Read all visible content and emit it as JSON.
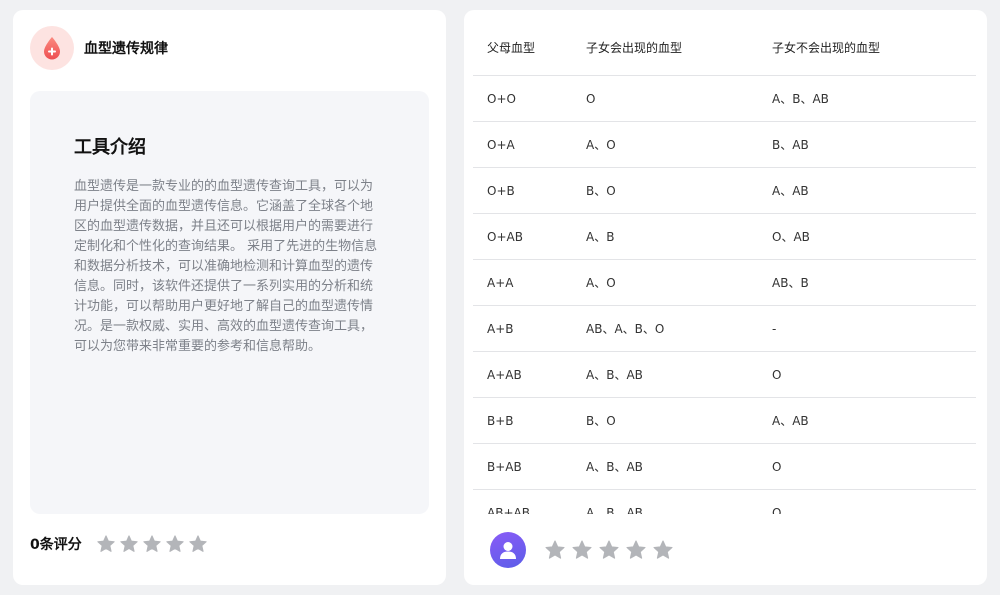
{
  "app": {
    "title": "血型遗传规律",
    "logo_icon": "blood-drop-icon"
  },
  "intro": {
    "heading": "工具介绍",
    "body": "血型遗传是一款专业的的血型遗传查询工具，可以为用户提供全面的血型遗传信息。它涵盖了全球各个地区的血型遗传数据，并且还可以根据用户的需要进行定制化和个性化的查询结果。 采用了先进的生物信息和数据分析技术，可以准确地检测和计算血型的遗传信息。同时，该软件还提供了一系列实用的分析和统计功能，可以帮助用户更好地了解自己的血型遗传情况。是一款权威、实用、高效的血型遗传查询工具，可以为您带来非常重要的参考和信息帮助。"
  },
  "rating": {
    "count_label": "0条评分",
    "stars": 5,
    "star_color": "#b3b5b9"
  },
  "table": {
    "headers": [
      "父母血型",
      "子女会出现的血型",
      "子女不会出现的血型"
    ],
    "rows": [
      [
        "O+O",
        "O",
        "A、B、AB"
      ],
      [
        "O+A",
        "A、O",
        "B、AB"
      ],
      [
        "O+B",
        "B、O",
        "A、AB"
      ],
      [
        "O+AB",
        "A、B",
        "O、AB"
      ],
      [
        "A+A",
        "A、O",
        "AB、B"
      ],
      [
        "A+B",
        "AB、A、B、O",
        "-"
      ],
      [
        "A+AB",
        "A、B、AB",
        "O"
      ],
      [
        "B+B",
        "B、O",
        "A、AB"
      ],
      [
        "B+AB",
        "A、B、AB",
        "O"
      ],
      [
        "AB+AB",
        "A、B、AB",
        "O"
      ]
    ]
  },
  "user_rating": {
    "avatar_icon": "user-avatar-icon",
    "stars": 5
  },
  "colors": {
    "accent": "#f2625c",
    "avatar": "#7a5cf0",
    "star": "#b3b5b9"
  }
}
